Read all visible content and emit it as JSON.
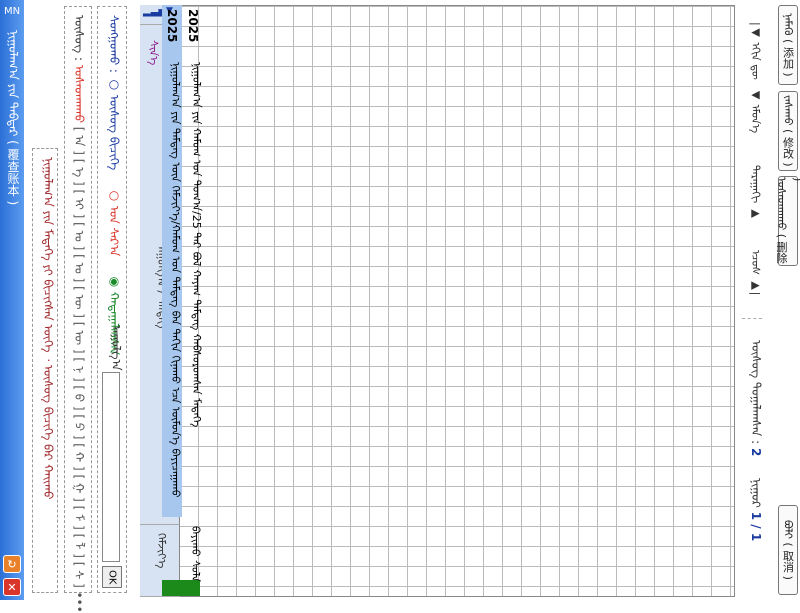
{
  "titlebar": {
    "badge": "MN",
    "title": "ᠨᠢᠭᠤᠯᠠᠭ᠎ᠠ ᠶᠢᠨ ᠳᠡᠪᠲᠡᠷ ( 覆查账本 )",
    "refresh_icon": "refresh-icon",
    "close_icon": "close-icon"
  },
  "notice": {
    "text": "ᠨᠢᠭᠤᠯᠠᠭ᠎ᠠ ᠶᠢᠨ ᠮᠡᠳᠡᠭᠡ ᠶᠢ ᠪᠢᠴᠢᠭᠰᠡᠨ ᠦᠭᠡ ᠂ ᠦᠰᠦᠭ ᠪᠢᠴᠢᠭᠡ ᠪᠠᠷ ᠬᠠᠢᠬᠤ"
  },
  "letters": {
    "label": "ᠦᠰᠦᠭ :",
    "delete": "ᠤᠰᠠᠳᠬᠠᠬᠤ",
    "keys": "[ ᠠ ] [ ᠡ ] [ ᠢ ] [ ᠣ ] [ ᠤ ] [ ᠥ ] [ ᠦ ] [ ᠨ ] [ ᠪ ] [ ᠫ ] [ ᠬ ] [ ᠭ ] [ ᠮ ] [ ᠯ ] [ ᠰ ] •••"
  },
  "search": {
    "select_label": "ᠰᠣᠩᠭᠣᠬᠤ :",
    "options": [
      "ᠦᠰᠦᠭ ᠪᠢᠴᠢᠭᠡ",
      "ᠣᠨ ᠰᠠᠷ᠎ᠠ",
      "ᠬᠠᠳᠠᠭᠠᠯᠠᠭᠰᠠᠨ"
    ],
    "text_label": "ᠠᠭᠤᠯᠭ᠎ᠠ :",
    "ok_label": "OK"
  },
  "table": {
    "signal": "▂▃▅▇",
    "tag": "ᠰᠢᠨ᠎ᠡ",
    "header_cols": [
      "ᠠᠭᠤᠯᠭ᠎ᠠ / ᠲᠡᠮᠳᠡᠭ",
      "ᠬᠡᠮᠵᠢᠶ᠎ᠡ"
    ],
    "rows": [
      {
        "date": "2025",
        "text": "ᠨᠢᠭᠤᠯᠠᠭ᠎ᠠ ᠶᠢᠨ ᠬᠠᠮᠤᠭ ᠤᠨ ᠲᠣᠭ᠎ᠠ/25 ᠲᠡᠷ ᠪᠣᠯ ᠬᠠᠶᠠᠭ ᠲᠡᠮᠳᠡᠭ ᠬᠠᠪᠰᠤᠷᠤᠭᠰᠠᠨ ᠮᠡᠳᠡᠭᠡ",
        "value": ""
      },
      {
        "date": "2025",
        "text": "ᠨᠢᠭᠤᠯᠠᠭ᠎ᠠ ᠶᠢᠨ ᠲᠡᠮᠳᠡᠭ ᠦᠨ ᠬᠡᠮᠵᠢᠶ᠎ᠡ/ᠬᠠᠮᠤᠭ ᠤᠨ ᠲᠡᠮᠳᠡᠭ ᠪᠠᠨ ᠳᠠᠬᠢᠨ ᠬᠢᠨᠠᠬᠤ ᠡᠴᠡ ᠦᠮᠦᠨ᠎ᠡ ᠪᠠᠶᠢᠴᠠᠭᠠᠬᠤ",
        "value": "ᠪᠠᠶᠢᠬᠤ ᠰᠤᠯᠠ"
      }
    ]
  },
  "nav": {
    "first": "|◀ ᠡᠬᠢᠨ ᠳᠦ",
    "prev": "◀ ᠡᠮᠦᠨ᠎ᠡ",
    "next": "ᠳᠠᠷᠠᠭᠠᠬᠢ ▶",
    "last": "ᠡᠴᠦᠰ ▶|"
  },
  "actions": {
    "add": "ᠨᠡᠮᠡᠬᠦ ( 添加 )",
    "edit": "ᠵᠠᠰᠠᠬᠤ ( 修改 )",
    "delete": "ᠤᠰᠠᠳᠬᠠᠬᠤ ( 删除 )",
    "cancel": "ᠪᠣᠯᠢ ( 取消 )"
  },
  "count": {
    "label": "ᠦᠰᠦᠭ ᠲᠣᠭᠠᠯᠠᠭᠰᠠᠨ :",
    "value": "2"
  },
  "page": {
    "label": "ᠨᠢᠭᠤᠷ",
    "value": "1 / 1"
  }
}
